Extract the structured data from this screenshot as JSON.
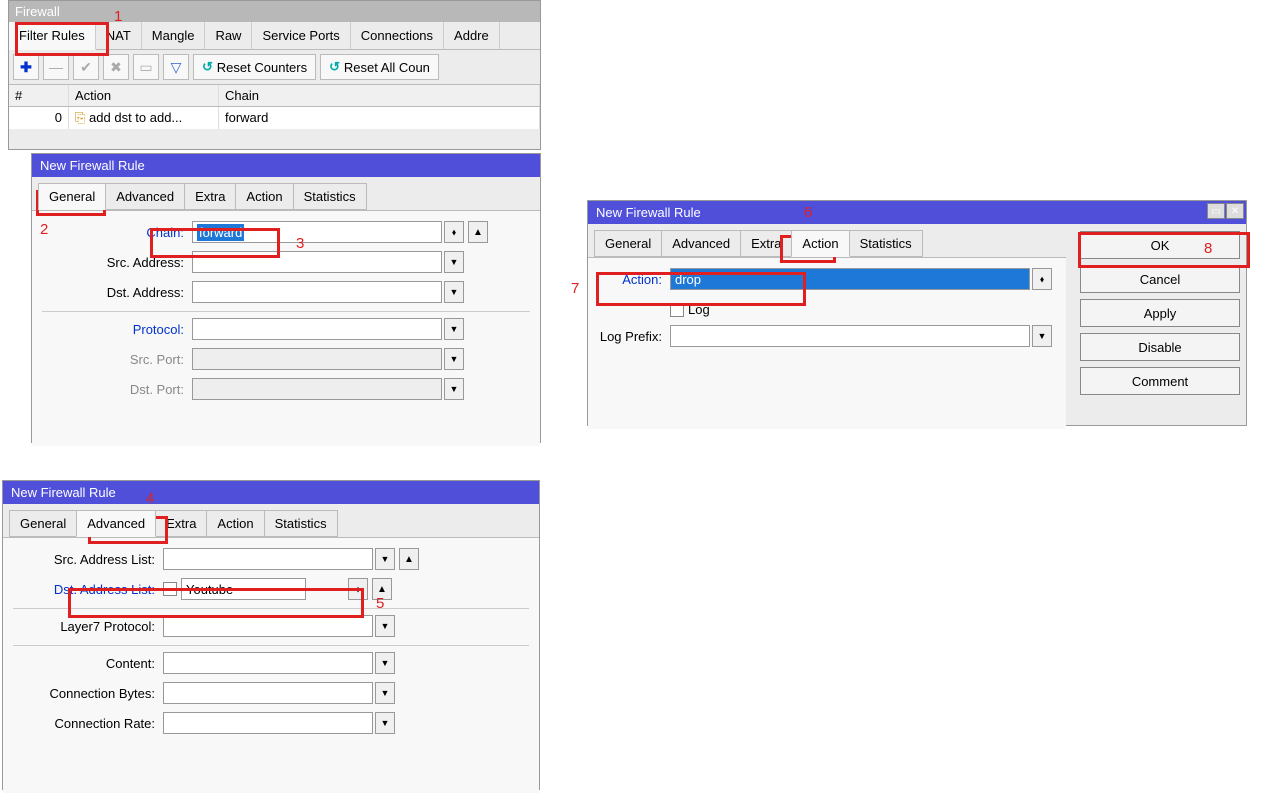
{
  "panel1": {
    "title": "Firewall",
    "tabs": [
      "Filter Rules",
      "NAT",
      "Mangle",
      "Raw",
      "Service Ports",
      "Connections",
      "Addre"
    ],
    "toolbar": {
      "reset": "Reset Counters",
      "resetAll": "Reset All Coun"
    },
    "grid": {
      "headers": [
        "#",
        "Action",
        "Chain"
      ],
      "row": {
        "num": "0",
        "action": "add dst to add...",
        "chain": "forward"
      }
    }
  },
  "rule1": {
    "title": "New Firewall Rule",
    "tabs": [
      "General",
      "Advanced",
      "Extra",
      "Action",
      "Statistics"
    ],
    "labels": {
      "chain": "Chain:",
      "srcAddr": "Src. Address:",
      "dstAddr": "Dst. Address:",
      "protocol": "Protocol:",
      "srcPort": "Src. Port:",
      "dstPort": "Dst. Port:"
    },
    "values": {
      "chain": "forward"
    }
  },
  "rule2": {
    "title": "New Firewall Rule",
    "tabs": [
      "General",
      "Advanced",
      "Extra",
      "Action",
      "Statistics"
    ],
    "labels": {
      "srcList": "Src. Address List:",
      "dstList": "Dst. Address List:",
      "l7": "Layer7 Protocol:",
      "content": "Content:",
      "connBytes": "Connection Bytes:",
      "connRate": "Connection Rate:"
    },
    "values": {
      "dstList": "Youtube"
    }
  },
  "rule3": {
    "title": "New Firewall Rule",
    "tabs": [
      "General",
      "Advanced",
      "Extra",
      "Action",
      "Statistics"
    ],
    "labels": {
      "action": "Action:",
      "log": "Log",
      "logPrefix": "Log Prefix:"
    },
    "values": {
      "action": "drop"
    },
    "buttons": [
      "OK",
      "Cancel",
      "Apply",
      "Disable",
      "Comment"
    ]
  },
  "annotations": {
    "n1": "1",
    "n2": "2",
    "n3": "3",
    "n4": "4",
    "n5": "5",
    "n6": "6",
    "n7": "7",
    "n8": "8"
  }
}
